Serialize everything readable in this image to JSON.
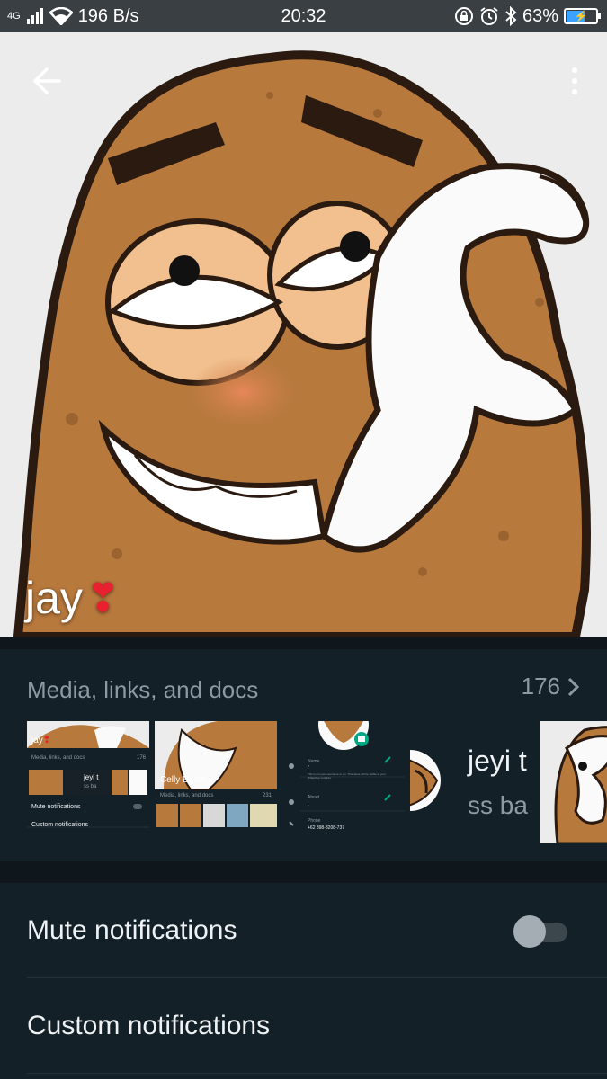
{
  "status_bar": {
    "network": "4G",
    "speed": "196 B/s",
    "time": "20:32",
    "battery": "63%",
    "battery_level": 0.63,
    "icons": [
      "signal-icon",
      "wifi-icon",
      "rotation-lock-icon",
      "alarm-icon",
      "bluetooth-icon",
      "battery-icon"
    ]
  },
  "header": {
    "back_icon": "arrow-left-icon",
    "menu_icon": "more-vertical-icon"
  },
  "profile": {
    "name": "jay",
    "emoji": "❣"
  },
  "media": {
    "title": "Media, links, and docs",
    "count": "176",
    "thumbs": [
      {
        "name": "jay",
        "emoji": "❣",
        "media_label": "Media, links, and docs",
        "count": "176",
        "preview_name": "jeyi t",
        "preview_sub": "ss ba",
        "mute": "Mute notifications",
        "custom": "Custom notifications"
      },
      {
        "name": "Celly Bacot",
        "media_label": "Media, links, and docs",
        "count": "231"
      },
      {
        "name_label": "Name",
        "name_value": "r",
        "name_hint": "This is not your username or pin. This name will be visible to your WhatsApp contacts.",
        "about_label": "About",
        "about_value": ".",
        "phone_label": "Phone",
        "phone_value": "+62 898-8208-737"
      },
      {
        "title": "jeyi t",
        "subtitle": "ss ba"
      },
      {}
    ]
  },
  "settings": {
    "mute_label": "Mute notifications",
    "mute_on": false,
    "custom_label": "Custom notifications"
  },
  "colors": {
    "background": "#0f161c",
    "panel": "#142028",
    "accent": "#00a884",
    "muted_text": "#8d9aa3",
    "potato": "#b8793d",
    "heart": "#e8202f"
  }
}
